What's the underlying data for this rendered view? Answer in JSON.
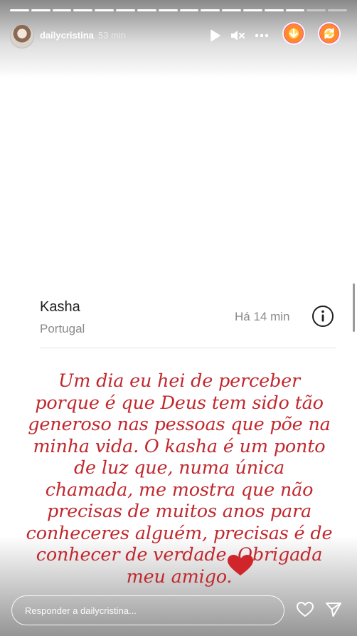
{
  "story": {
    "username": "dailycristina",
    "time_ago": "53 min",
    "progress": {
      "total_segments": 16,
      "active_segments": 14
    }
  },
  "header_icons": [
    "play-icon",
    "mute-icon",
    "more-options-icon",
    "download-extension-icon",
    "refresh-extension-icon"
  ],
  "card": {
    "name": "Kasha",
    "location": "Portugal",
    "time": "Há 14 min"
  },
  "message": {
    "text": "Um dia eu hei de perceber\nporque é que Deus tem sido tão\ngeneroso nas pessoas que põe na\nminha vida. O kasha é um ponto\nde luz que, numa única\nchamada, me mostra que não\nprecisas de muitos anos para\nconheceres alguém, precisas é de\nconhecer de verdade. Obrigada\nmeu amigo.",
    "color": "#c0282e"
  },
  "reply": {
    "placeholder": "Responder a dailycristina..."
  },
  "colors": {
    "heart": "#d0262b",
    "text_dark": "#1f1f1f",
    "text_muted": "#8a8a8a"
  }
}
